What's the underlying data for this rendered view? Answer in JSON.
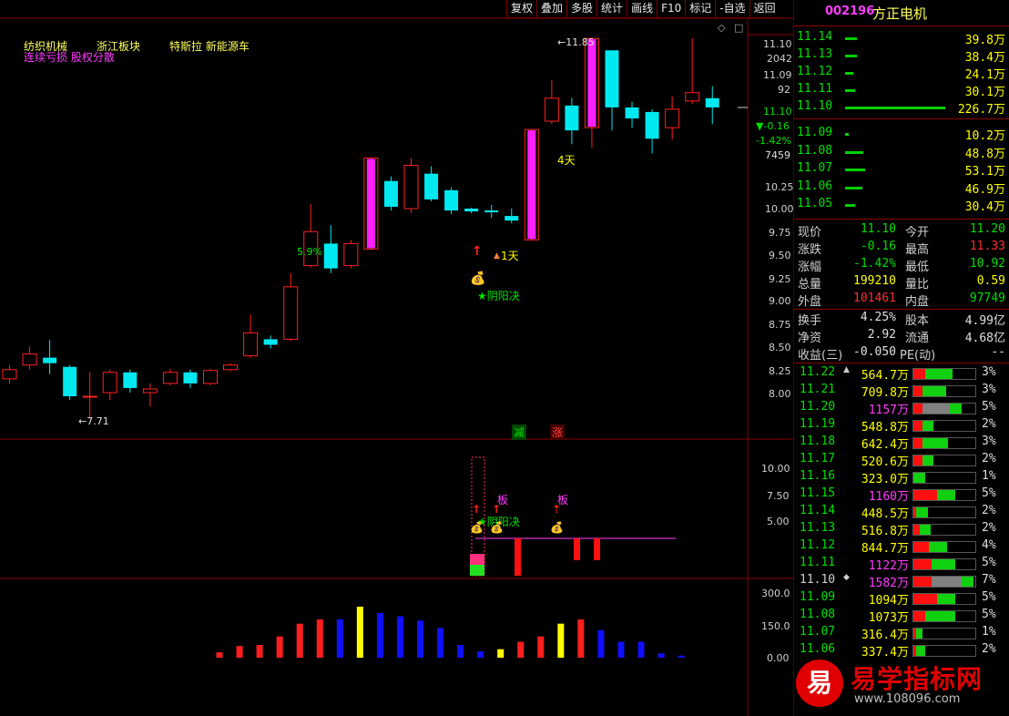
{
  "toolbar": {
    "items": [
      "复权",
      "叠加",
      "多股",
      "统计",
      "画线",
      "F10",
      "标记",
      "-自选",
      "返回"
    ]
  },
  "chart_header": {
    "tag_1": "纺织机械",
    "tag_2": "浙江板块",
    "tag_3": "特斯拉 新能源车",
    "tag_4": "连续亏损 股权分散"
  },
  "annotations": {
    "high_label": "←11.85",
    "low_label": "←7.71",
    "pct_label": "5.9%",
    "days_4": "4天",
    "days_1": "1天",
    "yinyang": "★阴阳决",
    "jian": "减",
    "zhang": "涨",
    "ban_1": "板",
    "ban_2": "板",
    "yinyang_sub": "★阴阳决"
  },
  "price_axis": {
    "labels": [
      "11.10",
      "2042",
      "11.09",
      "92",
      "11.10",
      "▼-0.16",
      "-1.42%",
      "7459",
      "10.25",
      "10.00",
      "9.75",
      "9.50",
      "9.25",
      "9.00",
      "8.75",
      "8.50",
      "8.25",
      "8.00"
    ]
  },
  "sub_axis": {
    "labels": [
      "10.00",
      "7.50",
      "5.00"
    ]
  },
  "vol_axis": {
    "labels": [
      "300.0",
      "150.0",
      "0.00"
    ]
  },
  "candles": [
    {
      "o": 8.15,
      "c": 8.25,
      "h": 8.3,
      "l": 8.1
    },
    {
      "o": 8.3,
      "c": 8.42,
      "h": 8.5,
      "l": 8.25
    },
    {
      "o": 8.38,
      "c": 8.32,
      "h": 8.57,
      "l": 8.2
    },
    {
      "o": 8.28,
      "c": 7.96,
      "h": 8.3,
      "l": 7.92
    },
    {
      "o": 7.96,
      "c": 7.96,
      "h": 8.22,
      "l": 7.71
    },
    {
      "o": 8.0,
      "c": 8.22,
      "h": 8.25,
      "l": 7.92
    },
    {
      "o": 8.22,
      "c": 8.05,
      "h": 8.25,
      "l": 8.0
    },
    {
      "o": 8.0,
      "c": 8.04,
      "h": 8.1,
      "l": 7.85
    },
    {
      "o": 8.1,
      "c": 8.22,
      "h": 8.26,
      "l": 8.08
    },
    {
      "o": 8.22,
      "c": 8.1,
      "h": 8.25,
      "l": 8.05
    },
    {
      "o": 8.1,
      "c": 8.24,
      "h": 8.26,
      "l": 8.08
    },
    {
      "o": 8.25,
      "c": 8.3,
      "h": 8.32,
      "l": 8.23
    },
    {
      "o": 8.4,
      "c": 8.65,
      "h": 8.85,
      "l": 8.38
    },
    {
      "o": 8.58,
      "c": 8.52,
      "h": 8.62,
      "l": 8.48
    },
    {
      "o": 8.58,
      "c": 9.15,
      "h": 9.3,
      "l": 8.56
    },
    {
      "o": 9.38,
      "c": 9.75,
      "h": 10.05,
      "l": 9.36
    },
    {
      "o": 9.62,
      "c": 9.35,
      "h": 9.82,
      "l": 9.3
    },
    {
      "o": 9.38,
      "c": 9.62,
      "h": 9.66,
      "l": 9.35
    },
    {
      "o": 9.56,
      "c": 10.55,
      "h": 10.55,
      "l": 9.55,
      "limit": true
    },
    {
      "o": 10.3,
      "c": 10.02,
      "h": 10.35,
      "l": 9.98
    },
    {
      "o": 10.0,
      "c": 10.47,
      "h": 10.55,
      "l": 9.95
    },
    {
      "o": 10.38,
      "c": 10.1,
      "h": 10.46,
      "l": 10.08
    },
    {
      "o": 10.2,
      "c": 9.98,
      "h": 10.23,
      "l": 9.94
    },
    {
      "o": 10.0,
      "c": 9.97,
      "h": 10.01,
      "l": 9.95
    },
    {
      "o": 9.98,
      "c": 9.96,
      "h": 10.04,
      "l": 9.9
    },
    {
      "o": 9.92,
      "c": 9.87,
      "h": 10.0,
      "l": 9.84
    },
    {
      "o": 9.66,
      "c": 10.86,
      "h": 10.86,
      "l": 9.66,
      "limit": true
    },
    {
      "o": 10.95,
      "c": 11.2,
      "h": 11.4,
      "l": 10.92
    },
    {
      "o": 11.12,
      "c": 10.85,
      "h": 11.2,
      "l": 10.7
    },
    {
      "o": 10.88,
      "c": 11.85,
      "h": 11.85,
      "l": 10.66,
      "limit": true
    },
    {
      "o": 11.72,
      "c": 11.1,
      "h": 11.72,
      "l": 10.85
    },
    {
      "o": 11.1,
      "c": 10.98,
      "h": 11.16,
      "l": 10.88
    },
    {
      "o": 11.05,
      "c": 10.76,
      "h": 11.08,
      "l": 10.6
    },
    {
      "o": 10.88,
      "c": 11.08,
      "h": 11.22,
      "l": 10.75
    },
    {
      "o": 11.17,
      "c": 11.26,
      "h": 11.85,
      "l": 11.14
    },
    {
      "o": 11.2,
      "c": 11.1,
      "h": 11.33,
      "l": 10.92
    }
  ],
  "volume_bars": [
    {
      "v": 25,
      "color": "#ff1e1e"
    },
    {
      "v": 55,
      "color": "#ff1e1e"
    },
    {
      "v": 60,
      "color": "#ff1e1e"
    },
    {
      "v": 100,
      "color": "#ff1e1e"
    },
    {
      "v": 160,
      "color": "#ff1e1e"
    },
    {
      "v": 180,
      "color": "#ff1e1e"
    },
    {
      "v": 180,
      "color": "#1010ff"
    },
    {
      "v": 240,
      "color": "#ffff00"
    },
    {
      "v": 210,
      "color": "#1010ff"
    },
    {
      "v": 195,
      "color": "#1010ff"
    },
    {
      "v": 175,
      "color": "#1010ff"
    },
    {
      "v": 140,
      "color": "#1010ff"
    },
    {
      "v": 60,
      "color": "#1010ff"
    },
    {
      "v": 30,
      "color": "#1010ff"
    },
    {
      "v": 40,
      "color": "#ffff00"
    },
    {
      "v": 75,
      "color": "#ff1e1e"
    },
    {
      "v": 100,
      "color": "#ff1e1e"
    },
    {
      "v": 160,
      "color": "#ffff00"
    },
    {
      "v": 180,
      "color": "#ff1e1e"
    },
    {
      "v": 130,
      "color": "#1010ff"
    },
    {
      "v": 75,
      "color": "#1010ff"
    },
    {
      "v": 75,
      "color": "#1010ff"
    },
    {
      "v": 20,
      "color": "#1010ff"
    },
    {
      "v": 10,
      "color": "#1010ff"
    }
  ],
  "stock": {
    "code": "002196",
    "name": "方正电机"
  },
  "order_book_sell": [
    {
      "price": "11.14",
      "vol": "39.8万",
      "bar": 0.12
    },
    {
      "price": "11.13",
      "vol": "38.4万",
      "bar": 0.12
    },
    {
      "price": "11.12",
      "vol": "24.1万",
      "bar": 0.08
    },
    {
      "price": "11.11",
      "vol": "30.1万",
      "bar": 0.1
    },
    {
      "price": "11.10",
      "vol": "226.7万",
      "bar": 1.0
    }
  ],
  "order_book_buy": [
    {
      "price": "11.09",
      "vol": "10.2万",
      "bar": 0.04
    },
    {
      "price": "11.08",
      "vol": "48.8万",
      "bar": 0.18
    },
    {
      "price": "11.07",
      "vol": "53.1万",
      "bar": 0.2
    },
    {
      "price": "11.06",
      "vol": "46.9万",
      "bar": 0.17
    },
    {
      "price": "11.05",
      "vol": "30.4万",
      "bar": 0.1
    }
  ],
  "quote": {
    "xianjia_l": "现价",
    "xianjia": "11.10",
    "jinkai_l": "今开",
    "jinkai": "11.20",
    "zhangdie_l": "涨跌",
    "zhangdie": "-0.16",
    "zuigao_l": "最高",
    "zuigao": "11.33",
    "zhangfu_l": "涨幅",
    "zhangfu": "-1.42%",
    "zuidi_l": "最低",
    "zuidi": "10.92",
    "zongliang_l": "总量",
    "zongliang": "199210",
    "liangbi_l": "量比",
    "liangbi": "0.59",
    "waipan_l": "外盘",
    "waipan": "101461",
    "neipan_l": "内盘",
    "neipan": "97749",
    "huanshou_l": "换手",
    "huanshou": "4.25%",
    "guben_l": "股本",
    "guben": "4.99亿",
    "jingzi_l": "净资",
    "jingzi": "2.92",
    "liutong_l": "流通",
    "liutong": "4.68亿",
    "shouyi_l": "收益(三)",
    "shouyi": "-0.050",
    "pe_l": "PE(动)",
    "pe": "--"
  },
  "volume_profile": [
    {
      "price": "11.22",
      "vol": "564.7万",
      "pct": "3%",
      "red": 0.2,
      "green": 0.45,
      "gray": 0,
      "pc": "#00e000",
      "vc": "#ffff00",
      "mark": "▲"
    },
    {
      "price": "11.21",
      "vol": "709.8万",
      "pct": "3%",
      "red": 0.15,
      "green": 0.4,
      "gray": 0,
      "pc": "#00e000",
      "vc": "#ffff00"
    },
    {
      "price": "11.20",
      "vol": "1157万",
      "pct": "5%",
      "red": 0.15,
      "green": 0.2,
      "gray": 0.45,
      "pc": "#00e000",
      "vc": "#ff3cff"
    },
    {
      "price": "11.19",
      "vol": "548.8万",
      "pct": "2%",
      "red": 0.15,
      "green": 0.18,
      "gray": 0,
      "pc": "#00e000",
      "vc": "#ffff00"
    },
    {
      "price": "11.18",
      "vol": "642.4万",
      "pct": "3%",
      "red": 0.15,
      "green": 0.42,
      "gray": 0,
      "pc": "#00e000",
      "vc": "#ffff00"
    },
    {
      "price": "11.17",
      "vol": "520.6万",
      "pct": "2%",
      "red": 0.15,
      "green": 0.18,
      "gray": 0,
      "pc": "#00e000",
      "vc": "#ffff00"
    },
    {
      "price": "11.16",
      "vol": "323.0万",
      "pct": "1%",
      "red": 0,
      "green": 0.2,
      "gray": 0,
      "pc": "#00e000",
      "vc": "#ffff00"
    },
    {
      "price": "11.15",
      "vol": "1160万",
      "pct": "5%",
      "red": 0.4,
      "green": 0.3,
      "gray": 0,
      "pc": "#00e000",
      "vc": "#ff3cff"
    },
    {
      "price": "11.14",
      "vol": "448.5万",
      "pct": "2%",
      "red": 0.05,
      "green": 0.2,
      "gray": 0,
      "pc": "#00e000",
      "vc": "#ffff00"
    },
    {
      "price": "11.13",
      "vol": "516.8万",
      "pct": "2%",
      "red": 0.1,
      "green": 0.18,
      "gray": 0,
      "pc": "#00e000",
      "vc": "#ffff00"
    },
    {
      "price": "11.12",
      "vol": "844.7万",
      "pct": "4%",
      "red": 0.25,
      "green": 0.3,
      "gray": 0,
      "pc": "#00e000",
      "vc": "#ffff00"
    },
    {
      "price": "11.11",
      "vol": "1122万",
      "pct": "5%",
      "red": 0.3,
      "green": 0.4,
      "gray": 0,
      "pc": "#00e000",
      "vc": "#ff3cff"
    },
    {
      "price": "11.10",
      "vol": "1582万",
      "pct": "7%",
      "red": 0.3,
      "green": 0.2,
      "gray": 0.5,
      "pc": "#d0d0d0",
      "vc": "#ff3cff",
      "mark": "◆"
    },
    {
      "price": "11.09",
      "vol": "1094万",
      "pct": "5%",
      "red": 0.4,
      "green": 0.3,
      "gray": 0,
      "pc": "#00e000",
      "vc": "#ffff00"
    },
    {
      "price": "11.08",
      "vol": "1073万",
      "pct": "5%",
      "red": 0.2,
      "green": 0.5,
      "gray": 0,
      "pc": "#00e000",
      "vc": "#ffff00"
    },
    {
      "price": "11.07",
      "vol": "316.4万",
      "pct": "1%",
      "red": 0.05,
      "green": 0.1,
      "gray": 0,
      "pc": "#00e000",
      "vc": "#ffff00"
    },
    {
      "price": "11.06",
      "vol": "337.4万",
      "pct": "2%",
      "red": 0.05,
      "green": 0.15,
      "gray": 0,
      "pc": "#00e000",
      "vc": "#ffff00"
    }
  ],
  "watermark": {
    "circle": "易",
    "title": "易学指标网",
    "url": "www.108096.com"
  }
}
